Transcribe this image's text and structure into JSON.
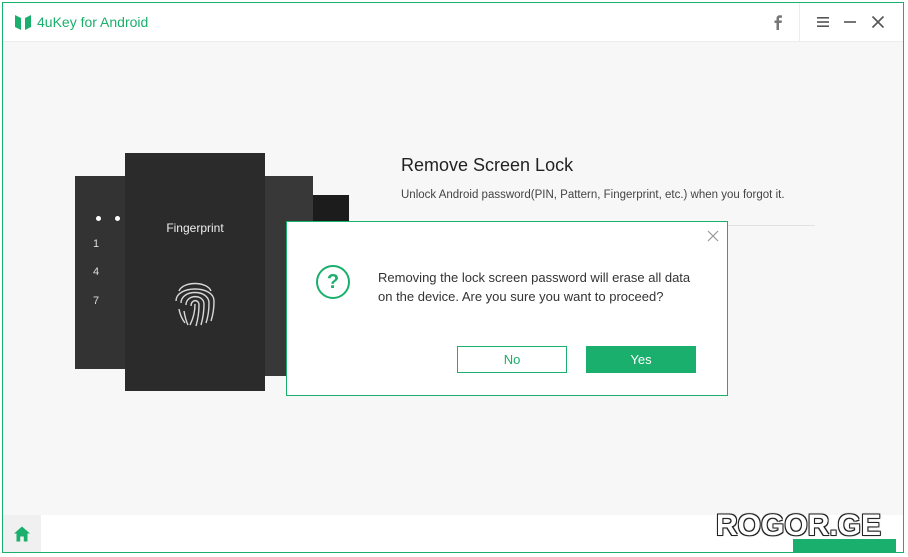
{
  "app": {
    "title": "4uKey for Android",
    "accent_color": "#1aaf6c"
  },
  "titlebar": {
    "icons": [
      "facebook-icon",
      "menu-icon",
      "minimize-icon",
      "close-icon"
    ]
  },
  "illustration": {
    "fingerprint_label": "Fingerprint",
    "keypad_digits": [
      "1",
      "4",
      "7"
    ]
  },
  "main": {
    "heading": "Remove Screen Lock",
    "subtext": "Unlock Android password(PIN, Pattern, Fingerprint, etc.) when you forgot it."
  },
  "dialog": {
    "icon": "question-icon",
    "message": "Removing the lock screen password will erase all data on the device. Are you sure you want to proceed?",
    "no_label": "No",
    "yes_label": "Yes"
  },
  "bottombar": {
    "home_icon": "home-icon"
  },
  "watermark": "ROGOR.GE"
}
